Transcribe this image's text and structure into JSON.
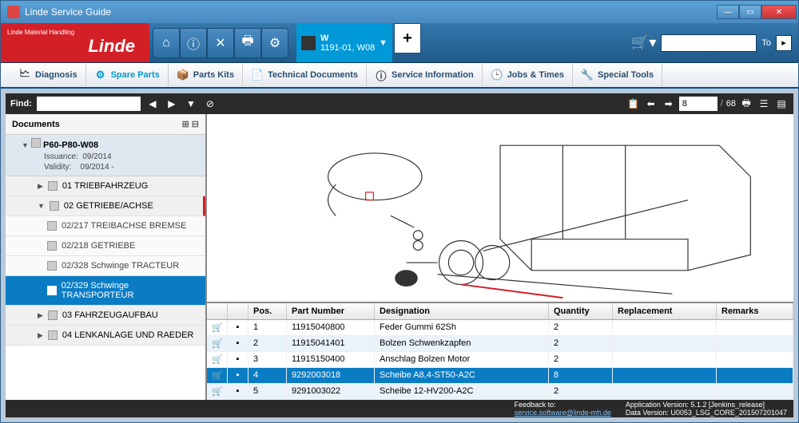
{
  "window": {
    "title": "Linde Service Guide"
  },
  "brand": {
    "sub": "Linde Material Handling",
    "logo": "Linde"
  },
  "vehicle": {
    "code": "W",
    "model": "1191-01, W08"
  },
  "cart": {
    "to_label": "To",
    "placeholder": ""
  },
  "tabs": {
    "diagnosis": "Diagnosis",
    "spare_parts": "Spare Parts",
    "parts_kits": "Parts Kits",
    "tech_docs": "Technical Documents",
    "service_info": "Service Information",
    "jobs_times": "Jobs & Times",
    "special_tools": "Special Tools"
  },
  "find": {
    "label": "Find:",
    "value": ""
  },
  "pager": {
    "current": "8",
    "total": "68",
    "sep": "/"
  },
  "sidebar": {
    "title": "Documents",
    "root": {
      "name": "P60-P80-W08",
      "issuance_label": "Issuance:",
      "issuance": "09/2014",
      "validity_label": "Validity:",
      "validity": "09/2014 -"
    },
    "items": [
      {
        "label": "01 TRIEBFAHRZEUG"
      },
      {
        "label": "02 GETRIEBE/ACHSE"
      },
      {
        "label": "02/217 TREIBACHSE BREMSE"
      },
      {
        "label": "02/218 GETRIEBE"
      },
      {
        "label": "02/328 Schwinge TRACTEUR"
      },
      {
        "label": "02/329 Schwinge TRANSPORTEUR"
      },
      {
        "label": "03 FAHRZEUGAUFBAU"
      },
      {
        "label": "04 LENKANLAGE UND RAEDER"
      }
    ]
  },
  "table": {
    "headers": {
      "pos": "Pos.",
      "part_number": "Part Number",
      "designation": "Designation",
      "quantity": "Quantity",
      "replacement": "Replacement",
      "remarks": "Remarks"
    },
    "rows": [
      {
        "pos": "1",
        "pn": "11915040800",
        "des": "Feder Gummi 62Sh",
        "qty": "2",
        "rep": "",
        "rem": ""
      },
      {
        "pos": "2",
        "pn": "11915041401",
        "des": "Bolzen Schwenkzapfen",
        "qty": "2",
        "rep": "",
        "rem": ""
      },
      {
        "pos": "3",
        "pn": "11915150400",
        "des": "Anschlag Bolzen Motor",
        "qty": "2",
        "rep": "",
        "rem": ""
      },
      {
        "pos": "4",
        "pn": "9292003018",
        "des": "Scheibe A8,4-ST50-A2C",
        "qty": "8",
        "rep": "",
        "rem": ""
      },
      {
        "pos": "5",
        "pn": "9291003022",
        "des": "Scheibe 12-HV200-A2C",
        "qty": "2",
        "rep": "",
        "rem": ""
      }
    ]
  },
  "footer": {
    "feedback_label": "Feedback to:",
    "feedback_email": "service.software@linde-mh.de",
    "app_version_label": "Application Version:",
    "app_version": "5.1.2 [Jenkins_release]",
    "data_version_label": "Data Version:",
    "data_version": "U0053_LSG_CORE_201507201047"
  }
}
